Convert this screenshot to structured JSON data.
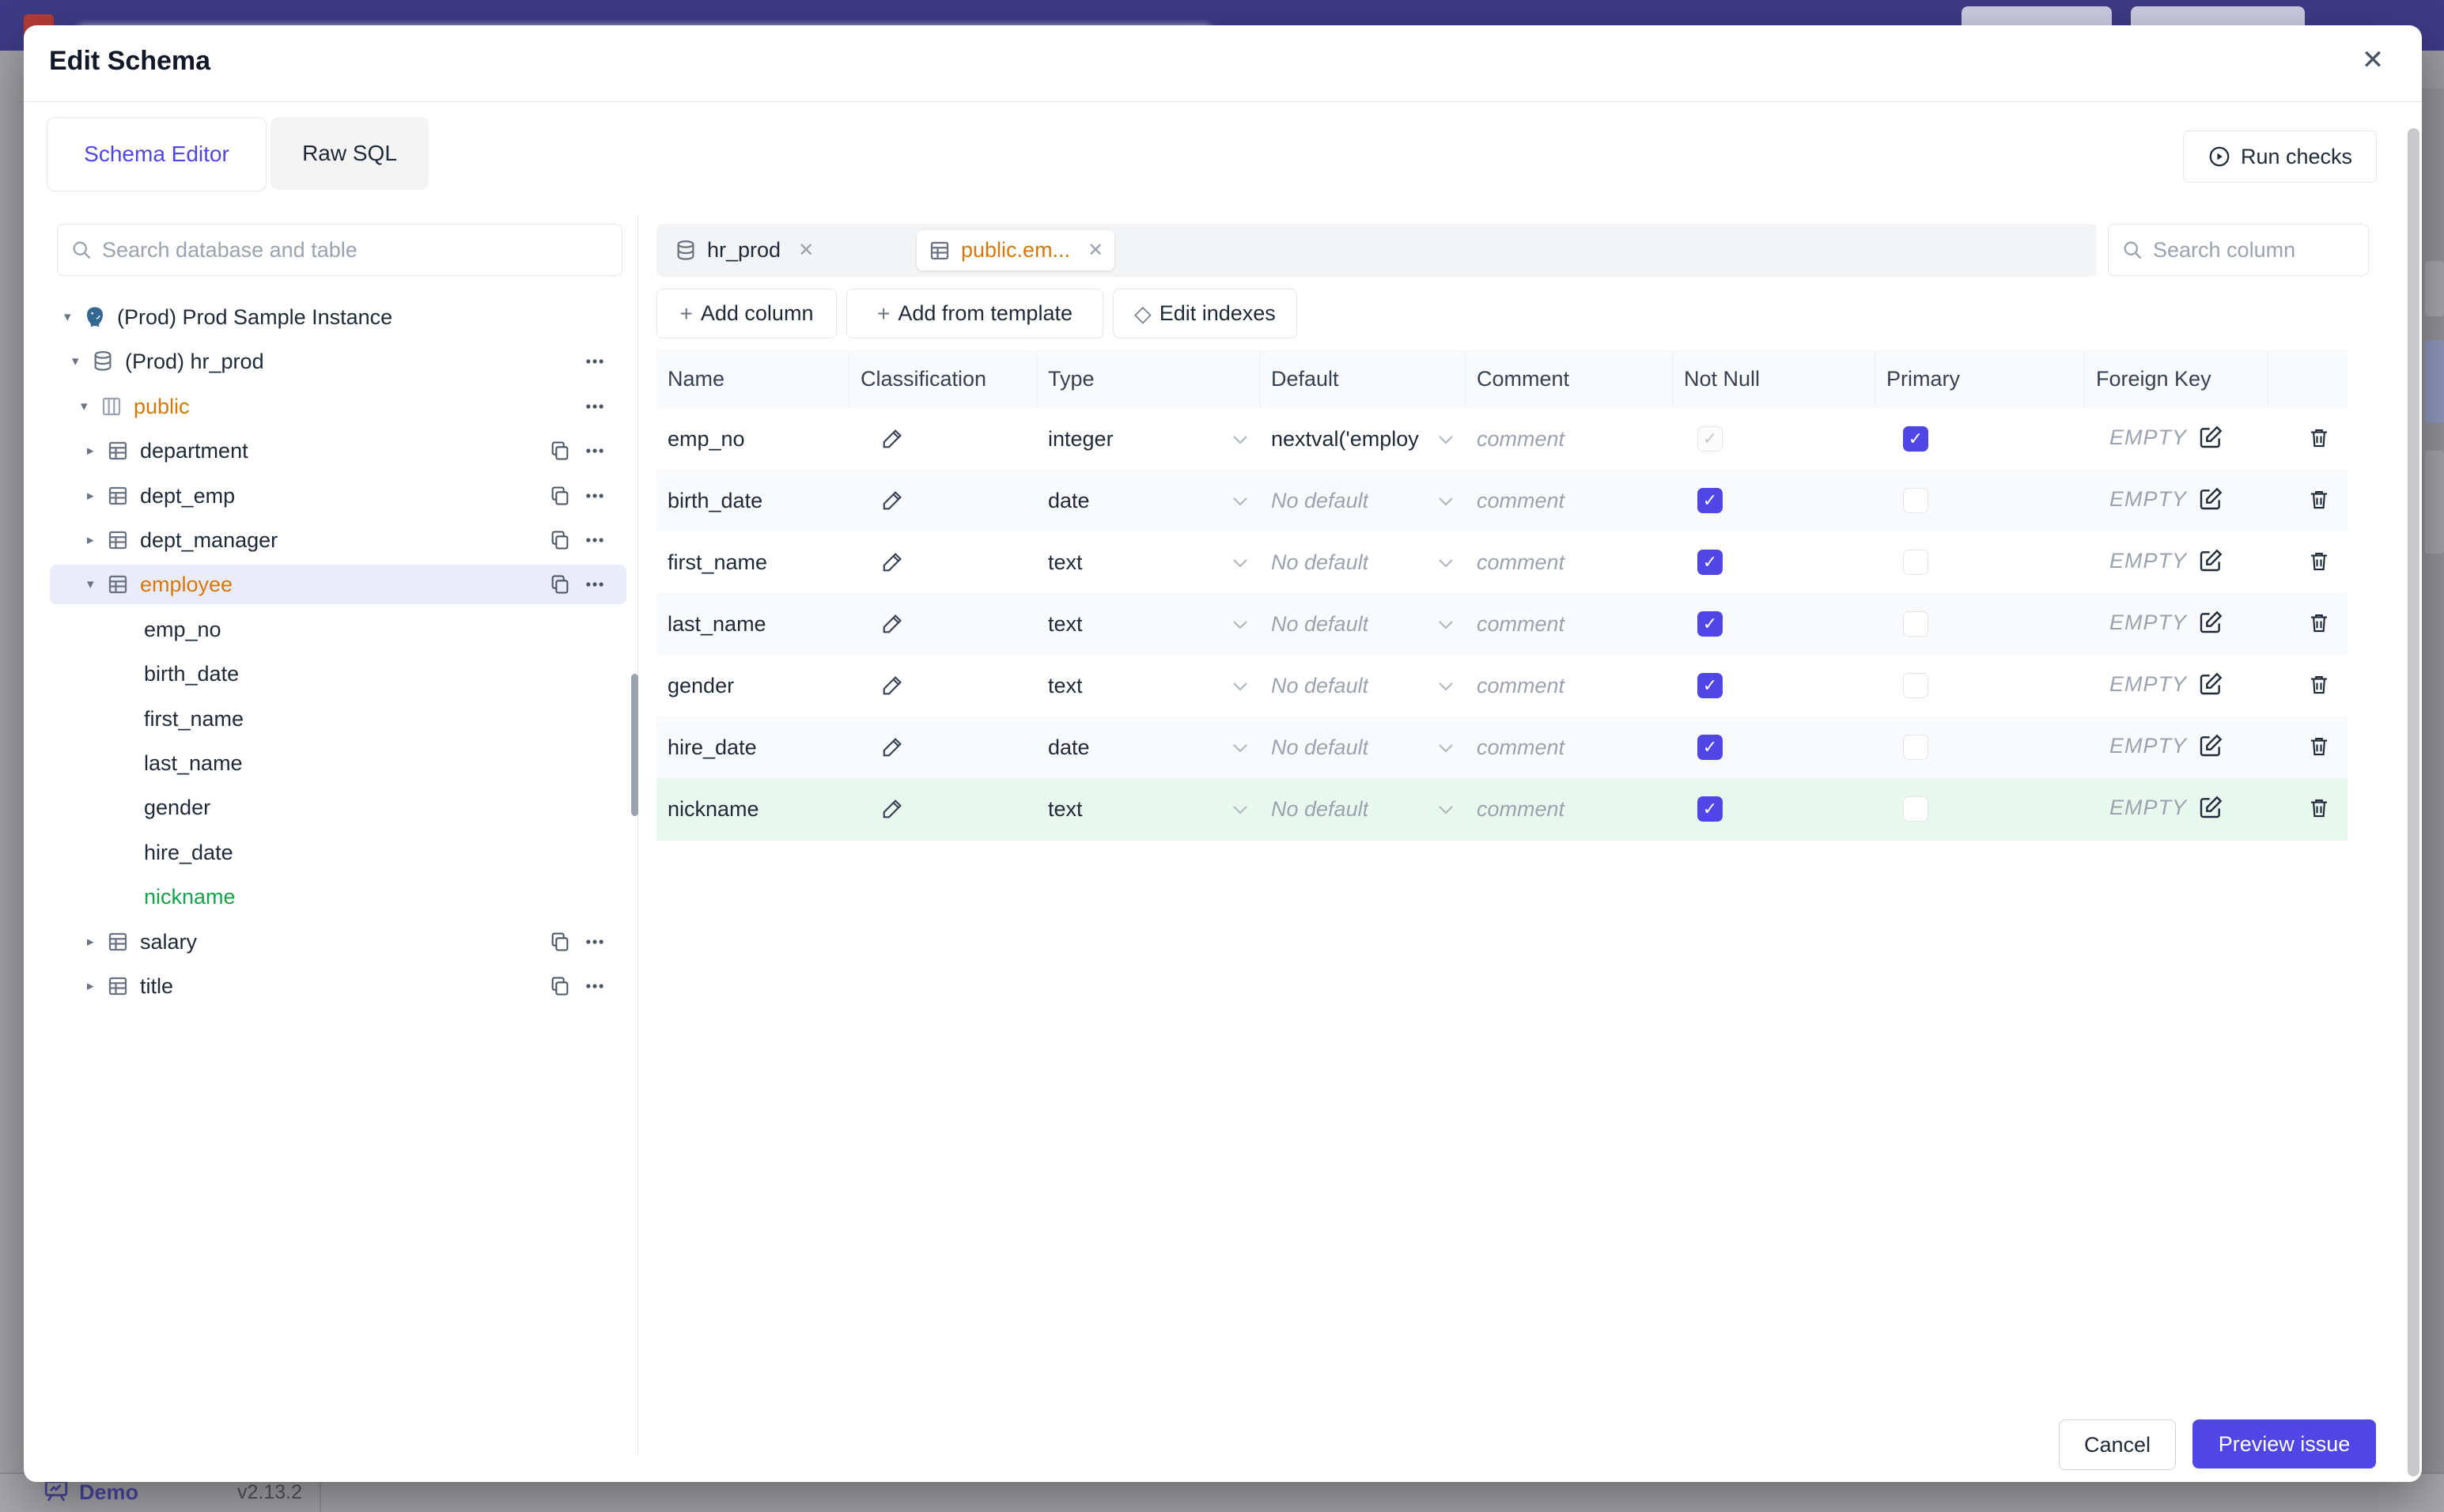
{
  "colors": {
    "accent": "#4f46e5",
    "amber": "#d97706",
    "green": "#16a34a",
    "green_row": "#e9f8ee",
    "stripe": "#f9fafb"
  },
  "modal": {
    "title": "Edit Schema",
    "close_icon": "✕",
    "tabs": [
      {
        "label": "Schema Editor",
        "active": true
      },
      {
        "label": "Raw SQL",
        "active": false
      }
    ],
    "run_checks_label": "Run checks"
  },
  "sidebar": {
    "search_placeholder": "Search database and table",
    "tree": [
      {
        "label": "(Prod) Prod Sample Instance",
        "icon": "postgres-icon",
        "level": 0,
        "caret": "expanded",
        "actions": []
      },
      {
        "label": "(Prod) hr_prod",
        "icon": "database-icon",
        "level": 1,
        "caret": "expanded",
        "actions": [
          "more"
        ]
      },
      {
        "label": "public",
        "icon": "schema-icon",
        "level": 2,
        "caret": "expanded",
        "color": "#d97706",
        "actions": [
          "more"
        ]
      },
      {
        "label": "department",
        "icon": "table-icon",
        "level": 3,
        "caret": "collapsed",
        "actions": [
          "copy",
          "more"
        ]
      },
      {
        "label": "dept_emp",
        "icon": "table-icon",
        "level": 3,
        "caret": "collapsed",
        "actions": [
          "copy",
          "more"
        ]
      },
      {
        "label": "dept_manager",
        "icon": "table-icon",
        "level": 3,
        "caret": "collapsed",
        "actions": [
          "copy",
          "more"
        ]
      },
      {
        "label": "employee",
        "icon": "table-icon",
        "level": 3,
        "caret": "expanded",
        "color": "#d97706",
        "selected": true,
        "actions": [
          "copy",
          "more"
        ]
      },
      {
        "label": "emp_no",
        "icon": null,
        "level": "col",
        "actions": []
      },
      {
        "label": "birth_date",
        "icon": null,
        "level": "col",
        "actions": []
      },
      {
        "label": "first_name",
        "icon": null,
        "level": "col",
        "actions": []
      },
      {
        "label": "last_name",
        "icon": null,
        "level": "col",
        "actions": []
      },
      {
        "label": "gender",
        "icon": null,
        "level": "col",
        "actions": []
      },
      {
        "label": "hire_date",
        "icon": null,
        "level": "col",
        "actions": []
      },
      {
        "label": "nickname",
        "icon": null,
        "level": "col",
        "color": "#16a34a",
        "actions": []
      },
      {
        "label": "salary",
        "icon": "table-icon",
        "level": 3,
        "caret": "collapsed",
        "actions": [
          "copy",
          "more"
        ]
      },
      {
        "label": "title",
        "icon": "table-icon",
        "level": 3,
        "caret": "collapsed",
        "actions": [
          "copy",
          "more"
        ]
      }
    ]
  },
  "main": {
    "chips": [
      {
        "label": "hr_prod",
        "icon": "database-icon",
        "active": false
      },
      {
        "label": "public.em...",
        "icon": "table-icon",
        "active": true,
        "color": "#d97706"
      }
    ],
    "column_search_placeholder": "Search column",
    "toolbar": [
      {
        "label": "Add column",
        "icon": "plus-icon",
        "symbol": "+"
      },
      {
        "label": "Add from template",
        "icon": "plus-icon",
        "symbol": "+"
      },
      {
        "label": "Edit indexes",
        "icon": "diamond-icon",
        "symbol": "◇"
      }
    ],
    "table": {
      "headers": [
        "Name",
        "Classification",
        "Type",
        "Default",
        "Comment",
        "Not Null",
        "Primary",
        "Foreign Key",
        ""
      ],
      "comment_placeholder": "comment",
      "foreign_key_empty": "EMPTY",
      "rows": [
        {
          "name": "emp_no",
          "type": "integer",
          "default": "nextval('employ",
          "default_is_placeholder": false,
          "not_null": "checked-disabled",
          "primary": true,
          "highlight": false
        },
        {
          "name": "birth_date",
          "type": "date",
          "default": "No default",
          "default_is_placeholder": true,
          "not_null": "checked",
          "primary": false,
          "highlight": false
        },
        {
          "name": "first_name",
          "type": "text",
          "default": "No default",
          "default_is_placeholder": true,
          "not_null": "checked",
          "primary": false,
          "highlight": false
        },
        {
          "name": "last_name",
          "type": "text",
          "default": "No default",
          "default_is_placeholder": true,
          "not_null": "checked",
          "primary": false,
          "highlight": false
        },
        {
          "name": "gender",
          "type": "text",
          "default": "No default",
          "default_is_placeholder": true,
          "not_null": "checked",
          "primary": false,
          "highlight": false
        },
        {
          "name": "hire_date",
          "type": "date",
          "default": "No default",
          "default_is_placeholder": true,
          "not_null": "checked",
          "primary": false,
          "highlight": false
        },
        {
          "name": "nickname",
          "type": "text",
          "default": "No default",
          "default_is_placeholder": true,
          "not_null": "checked",
          "primary": false,
          "highlight": true
        }
      ]
    },
    "footer": {
      "cancel_label": "Cancel",
      "primary_label": "Preview issue"
    }
  },
  "background": {
    "demo_label": "Demo",
    "version": "v2.13.2"
  }
}
